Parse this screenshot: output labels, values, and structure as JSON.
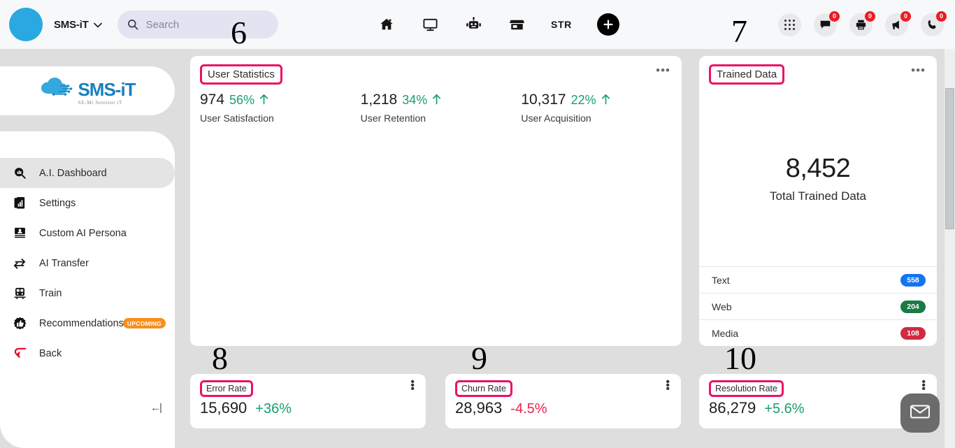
{
  "topbar": {
    "brand": "SMS-iT",
    "chevron": "⌄",
    "search_placeholder": "Search",
    "search_value": "",
    "nav_icons": [
      {
        "name": "home-icon",
        "label": "Home"
      },
      {
        "name": "monitor-icon",
        "label": "Desktop"
      },
      {
        "name": "robot-icon",
        "label": "AI Bot"
      },
      {
        "name": "store-icon",
        "label": "Store"
      }
    ],
    "str_label": "STR",
    "plus_label": "+",
    "right_icons": [
      {
        "name": "apps-grid-icon",
        "badge": null
      },
      {
        "name": "chat-icon",
        "badge": "0"
      },
      {
        "name": "printer-icon",
        "badge": "0"
      },
      {
        "name": "megaphone-icon",
        "badge": "0"
      },
      {
        "name": "phone-icon",
        "badge": "0"
      }
    ]
  },
  "sidebar": {
    "logo_main": "SMS-iT",
    "logo_sub": "SE-Mi Sentient iT",
    "collapse_label": "←|",
    "items": [
      {
        "label": "A.I. Dashboard",
        "icon": "search-chart-icon",
        "active": true,
        "badge": null
      },
      {
        "label": "Settings",
        "icon": "report-icon",
        "active": false,
        "badge": null
      },
      {
        "label": "Custom AI Persona",
        "icon": "id-card-icon",
        "active": false,
        "badge": null
      },
      {
        "label": "AI Transfer",
        "icon": "transfer-arrows-icon",
        "active": false,
        "badge": null
      },
      {
        "label": "Train",
        "icon": "train-icon",
        "active": false,
        "badge": null
      },
      {
        "label": "Recommendations",
        "icon": "thumbs-up-icon",
        "active": false,
        "badge": "UPCOMING"
      },
      {
        "label": "Back",
        "icon": "back-arrow-icon",
        "active": false,
        "badge": null
      }
    ]
  },
  "annotations": {
    "n6": "6",
    "n7": "7",
    "n8": "8",
    "n9": "9",
    "n10": "10"
  },
  "cards": {
    "user_statistics": {
      "title": "User Statistics",
      "menu": "•••",
      "stats": [
        {
          "value": "974",
          "percent": "56%",
          "trend": "up",
          "label": "User Satisfaction"
        },
        {
          "value": "1,218",
          "percent": "34%",
          "trend": "up",
          "label": "User Retention"
        },
        {
          "value": "10,317",
          "percent": "22%",
          "trend": "up",
          "label": "User Acquisition"
        }
      ]
    },
    "trained_data": {
      "title": "Trained Data",
      "menu": "•••",
      "total_value": "8,452",
      "total_label": "Total Trained Data",
      "rows": [
        {
          "label": "Text",
          "count": "558",
          "color": "#1574f0"
        },
        {
          "label": "Web",
          "count": "204",
          "color": "#1b7a45"
        },
        {
          "label": "Media",
          "count": "108",
          "color": "#cf2b40"
        }
      ]
    },
    "error_rate": {
      "title": "Error Rate",
      "value": "15,690",
      "delta": "+36%",
      "delta_sign": "pos"
    },
    "churn_rate": {
      "title": "Churn Rate",
      "value": "28,963",
      "delta": "-4.5%",
      "delta_sign": "neg"
    },
    "resolution_rate": {
      "title": "Resolution Rate",
      "value": "86,279",
      "delta": "+5.6%",
      "delta_sign": "pos"
    }
  },
  "fab": {
    "name": "mail-chat-button",
    "label": "Message"
  },
  "colors": {
    "accent_pink": "#ec1164",
    "brand_blue": "#29a9e0",
    "positive_green": "#18a06a",
    "negative_red": "#ec2247",
    "badge_red": "#ec1c24",
    "upcoming_orange": "#f7901e",
    "page_bg": "#dedede"
  }
}
